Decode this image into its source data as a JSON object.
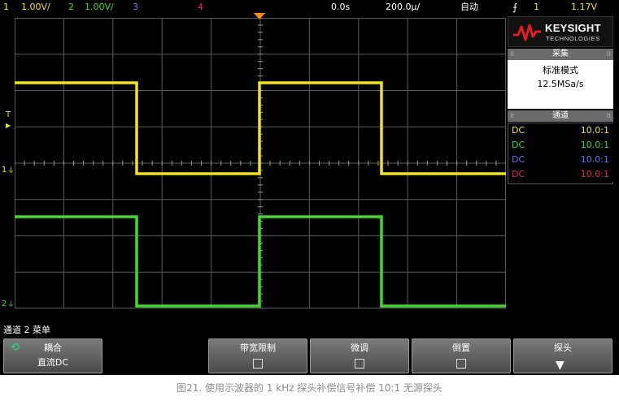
{
  "statusbar": {
    "ch1_num": "1",
    "ch1_scale": "1.00V/",
    "ch2_num": "2",
    "ch2_scale": "1.00V/",
    "ch3_num": "3",
    "ch4_num": "4",
    "time_delay": "0.0s",
    "time_scale": "200.0µ/",
    "trigger_mode": "自动",
    "trigger_icon": "trigger-edge-icon",
    "trigger_source": "1",
    "trigger_level": "1.17V"
  },
  "logo": {
    "brand": "KEYSIGHT",
    "sub": "TECHNOLOGIES"
  },
  "acquisition": {
    "header": "采集",
    "mode": "标准模式",
    "rate": "12.5MSa/s"
  },
  "channels_panel": {
    "header": "通道",
    "rows": [
      {
        "coupling": "DC",
        "probe": "10.0:1",
        "color": "#f2e60c"
      },
      {
        "coupling": "DC",
        "probe": "10.0:1",
        "color": "#3cdc28"
      },
      {
        "coupling": "DC",
        "probe": "10.0:1",
        "color": "#5c74ff"
      },
      {
        "coupling": "DC",
        "probe": "10.0:1",
        "color": "#e81e6e"
      }
    ]
  },
  "markers": {
    "trigger_level_marker": "T",
    "ch1_ground": "1",
    "ch2_ground": "2"
  },
  "menu_title": "通道 2 菜单",
  "softkeys": {
    "coupling_label": "耦合",
    "coupling_value": "直流DC",
    "bw_limit_label": "带宽限制",
    "fine_label": "微调",
    "invert_label": "倒置",
    "probe_label": "探头"
  },
  "colors": {
    "ch1": "#f2e60c",
    "ch2": "#3cdc28",
    "ch3": "#5c74ff",
    "ch4": "#e81e6e",
    "trigger": "#ff8c00",
    "grid": "#5a5a5a"
  },
  "icons": {
    "cycle": "cycle-arrow-icon",
    "probe_menu": "down-arrow-icon",
    "brand_mark": "keysight-wave-logo"
  },
  "caption": "图21. 使用示波器的 1 kHz 探头补偿信号补偿 10:1 无源探头"
}
